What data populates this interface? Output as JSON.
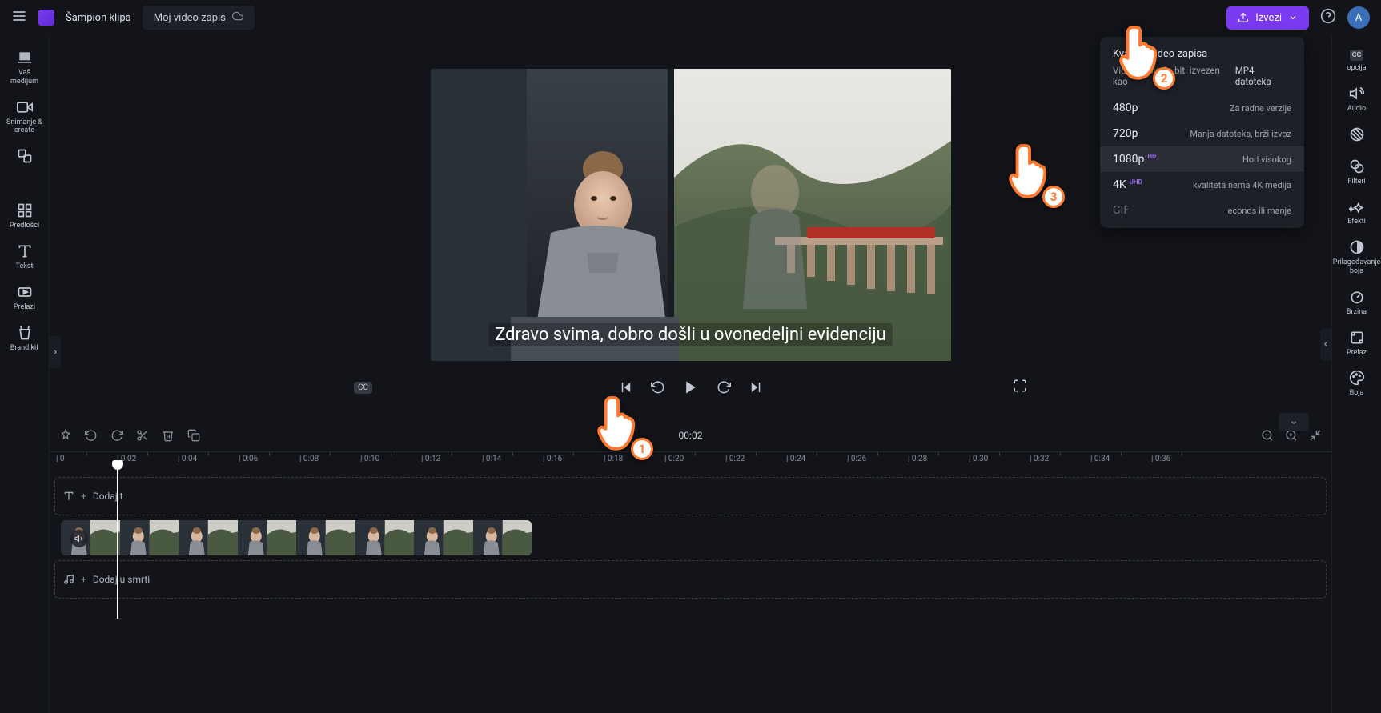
{
  "topbar": {
    "champion_label": "Šampion klipa",
    "project_name": "Moj video zapis",
    "export_label": "Izvezi",
    "avatar_letter": "A"
  },
  "left_sidebar": {
    "items": [
      {
        "label": "Vaš medijum",
        "icon": "media-icon"
      },
      {
        "label": "Snimanje &amp; create",
        "icon": "camera-icon"
      },
      {
        "label": "",
        "icon": "layers-icon"
      },
      {
        "label": "Predlošci",
        "icon": "templates-icon"
      },
      {
        "label": "Tekst",
        "icon": "text-icon"
      },
      {
        "label": "Prelazi",
        "icon": "transitions-icon"
      },
      {
        "label": "Brand kit",
        "icon": "brandkit-icon"
      }
    ]
  },
  "right_sidebar": {
    "items": [
      {
        "label": "opcija",
        "icon": "cc-icon"
      },
      {
        "label": "Audio",
        "icon": "audio-icon"
      },
      {
        "label": "",
        "icon": "fade-icon"
      },
      {
        "label": "Filteri",
        "icon": "filters-icon"
      },
      {
        "label": "Efekti",
        "icon": "effects-icon"
      },
      {
        "label": "Prilagođavanje boja",
        "icon": "contrast-icon"
      },
      {
        "label": "Brzina",
        "icon": "speed-icon"
      },
      {
        "label": "Prelaz",
        "icon": "crop-icon"
      },
      {
        "label": "Boja",
        "icon": "color-icon"
      }
    ]
  },
  "preview": {
    "subtitle_text": "Zdravo svima, dobro došli u ovonedeljni evidenciju",
    "cc_badge": "CC"
  },
  "timeline": {
    "timecode": "00:02",
    "text_track_label": "Dodaj t",
    "music_track_label": "Dodaj u smrti",
    "ruler": [
      "0",
      "0:02",
      "0:04",
      "0:06",
      "0:08",
      "0:10",
      "0:12",
      "0:14",
      "0:16",
      "0:18",
      "0:20",
      "0:22",
      "0:24",
      "0:26",
      "0:28",
      "0:30",
      "0:32",
      "0:34",
      "0:36"
    ]
  },
  "export_panel": {
    "title": "Kvalitet video zapisa",
    "subtitle_left": "Video zapis će biti izvezen kao",
    "subtitle_right": "MP4 datoteka",
    "options": [
      {
        "name": "480p",
        "badge": "",
        "desc": "Za radne verzije"
      },
      {
        "name": "720p",
        "badge": "",
        "desc": "Manja datoteka, brži izvoz"
      },
      {
        "name": "1080p",
        "badge": "HD",
        "desc": "Hod visokog"
      },
      {
        "name": "4K",
        "badge": "UHD",
        "desc": "kvaliteta nema 4K medija"
      },
      {
        "name": "GIF",
        "badge": "",
        "desc": "econds ili manje"
      }
    ]
  },
  "pointers": {
    "p1": "1",
    "p2": "2",
    "p3": "3"
  }
}
